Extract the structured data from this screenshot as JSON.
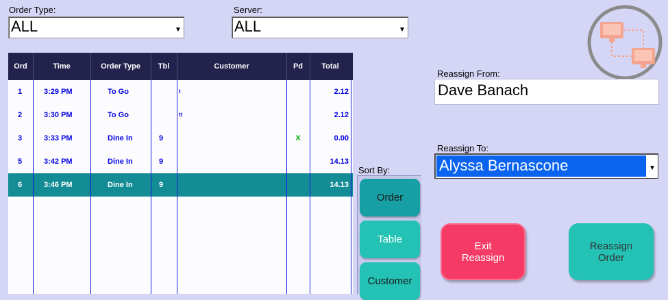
{
  "filters": {
    "order_type_label": "Order Type:",
    "order_type_value": "ALL",
    "server_label": "Server:",
    "server_value": "ALL"
  },
  "grid": {
    "columns": [
      "Ord",
      "Time",
      "Order Type",
      "Tbl",
      "Customer",
      "Pd",
      "Total"
    ],
    "rows": [
      {
        "ord": "1",
        "time": "3:29 PM",
        "type": "To Go",
        "tbl": "",
        "customer": "t",
        "pd": "",
        "total": "2.12",
        "selected": false
      },
      {
        "ord": "2",
        "time": "3:30 PM",
        "type": "To Go",
        "tbl": "",
        "customer": "tt",
        "pd": "",
        "total": "2.12",
        "selected": false
      },
      {
        "ord": "3",
        "time": "3:33 PM",
        "type": "Dine In",
        "tbl": "9",
        "customer": "",
        "pd": "X",
        "total": "0.00",
        "selected": false
      },
      {
        "ord": "5",
        "time": "3:42 PM",
        "type": "Dine In",
        "tbl": "9",
        "customer": "",
        "pd": "",
        "total": "14.13",
        "selected": false
      },
      {
        "ord": "6",
        "time": "3:46 PM",
        "type": "Dine In",
        "tbl": "9",
        "customer": "",
        "pd": "",
        "total": "14.13",
        "selected": true
      }
    ]
  },
  "sort": {
    "label": "Sort By:",
    "options": [
      "Order",
      "Table",
      "Customer"
    ],
    "active": "Order"
  },
  "reassign": {
    "from_label": "Reassign From:",
    "from_value": "Dave Banach",
    "to_label": "Reassign To:",
    "to_value": "Alyssa Bernascone"
  },
  "buttons": {
    "exit_line1": "Exit",
    "exit_line2": "Reassign",
    "reassign_line1": "Reassign",
    "reassign_line2": "Order"
  },
  "icons": {
    "network": "network-transfer-icon",
    "dropdown": "chevron-down-icon"
  },
  "colors": {
    "background": "#d5d5f6",
    "grid_header": "#22224d",
    "selected_row": "#138c96",
    "teal_button": "#23c2b5",
    "exit_button": "#f53a66",
    "selection_blue": "#0a64f0"
  }
}
